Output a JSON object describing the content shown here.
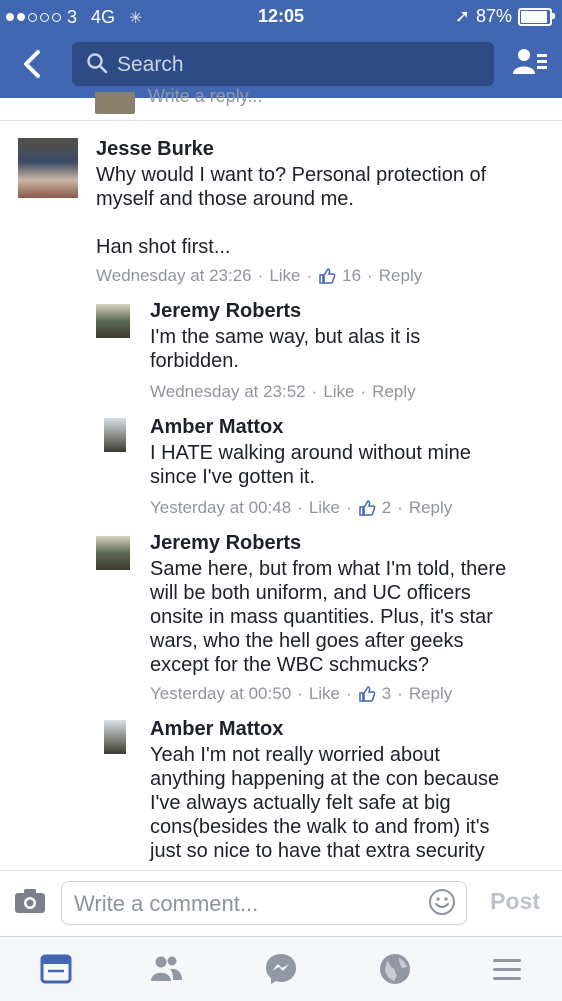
{
  "status_bar": {
    "carrier": "3",
    "network": "4G",
    "time": "12:05",
    "battery": "87%"
  },
  "nav": {
    "search_placeholder": "Search"
  },
  "previous_reply_stub": "Write a reply...",
  "comments": [
    {
      "name": "Jesse Burke",
      "lines": [
        "Why would I want to?  Personal protection of",
        "myself and those around me.",
        "",
        "Han shot first..."
      ],
      "time": "Wednesday at 23:26",
      "like": "Like",
      "likes": "16",
      "reply": "Reply"
    },
    {
      "name": "Jeremy Roberts",
      "lines": [
        "I'm the same way, but alas it is",
        "forbidden."
      ],
      "time": "Wednesday at 23:52",
      "like": "Like",
      "reply": "Reply"
    },
    {
      "name": "Amber Mattox",
      "lines": [
        "I HATE walking around without mine",
        "since I've gotten it."
      ],
      "time": "Yesterday at 00:48",
      "like": "Like",
      "likes": "2",
      "reply": "Reply"
    },
    {
      "name": "Jeremy Roberts",
      "lines": [
        "Same here, but from what I'm told, there",
        "will be both uniform, and UC officers",
        "onsite in mass quantities. Plus, it's star",
        "wars, who the hell goes after geeks",
        "except for the WBC schmucks?"
      ],
      "time": "Yesterday at 00:50",
      "like": "Like",
      "likes": "3",
      "reply": "Reply"
    },
    {
      "name": "Amber Mattox",
      "lines": [
        "Yeah I'm not really worried about",
        "anything happening at the con because",
        "I've always actually felt safe at big",
        "cons(besides the walk to and from) it's",
        "just so nice to have that extra security"
      ]
    }
  ],
  "composer": {
    "placeholder": "Write a comment...",
    "post_label": "Post"
  },
  "tabs": [
    "news-feed-icon",
    "friends-icon",
    "messenger-icon",
    "globe-icon",
    "menu-icon"
  ],
  "colors": {
    "brand": "#4267b2",
    "search_bg": "#2e4b85",
    "meta_text": "#90949c",
    "active_tab": "#4267b2",
    "inactive_tab": "#9197a3"
  }
}
